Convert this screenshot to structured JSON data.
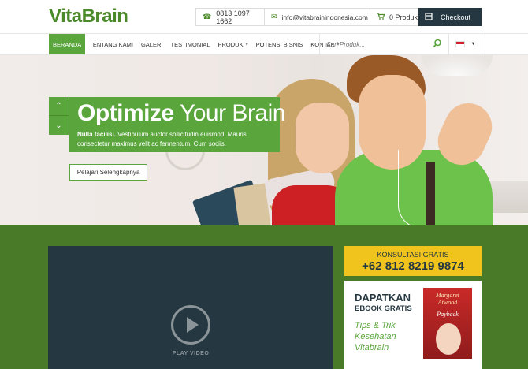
{
  "brand": {
    "name": "VitaBrain",
    "accent": "#5aa63d",
    "dark": "#253841",
    "yellow": "#f0c41c"
  },
  "topbar": {
    "phone": "0813 1097 1662",
    "phone_icon": "phone-icon",
    "email": "info@vitabrainindonesia.com",
    "email_icon": "envelope-icon",
    "cart_count": "0",
    "cart_label": "Produk",
    "cart_icon": "cart-icon",
    "checkout_label": "Checkout",
    "checkout_icon": "checkout-icon"
  },
  "nav": {
    "items": [
      {
        "label": "BERANDA",
        "active": true
      },
      {
        "label": "TENTANG KAMI"
      },
      {
        "label": "GALERI"
      },
      {
        "label": "TESTIMONIAL"
      },
      {
        "label": "PRODUK",
        "dropdown": true
      },
      {
        "label": "POTENSI BISNIS"
      },
      {
        "label": "KONTAK",
        "dropdown": true
      }
    ],
    "search_placeholder": "Cari Produk...",
    "language": "Indonesia flag"
  },
  "hero": {
    "title_bold": "Optimize",
    "title_rest": "Your Brain",
    "text_bold": "Nulla facilisi.",
    "text_rest": "Vestibulum auctor sollicitudin euismod. Mauris consectetur maximus velit ac fermentum. Cum sociis.",
    "button_label": "Pelajari Selengkapnya",
    "prev_icon": "chevron-up-icon",
    "next_icon": "chevron-down-icon"
  },
  "video": {
    "label": "PLAY VIDEO",
    "icon": "play-icon"
  },
  "consult": {
    "title": "KONSULTASI GRATIS",
    "phone": "+62 812 8219 9874"
  },
  "ebook": {
    "heading1": "DAPATKAN",
    "heading2": "EBOOK GRATIS",
    "tips": "Tips & Trik Kesehatan Vitabrain",
    "cover_author_first": "Margaret",
    "cover_author_last": "Atwood",
    "cover_title": "Payback"
  }
}
